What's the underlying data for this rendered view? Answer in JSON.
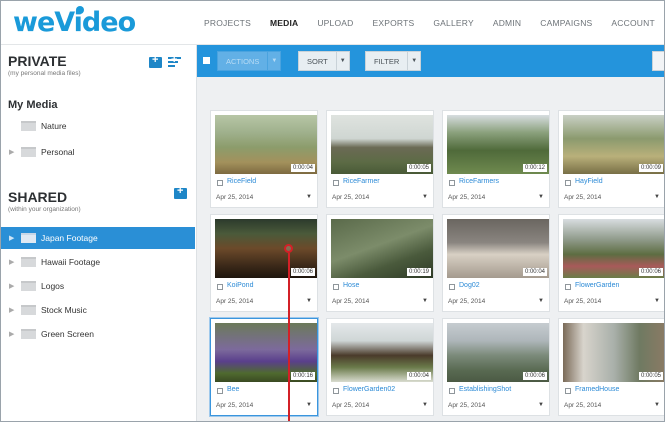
{
  "app": {
    "logo": "weVideo"
  },
  "nav": [
    "PROJECTS",
    "MEDIA",
    "UPLOAD",
    "EXPORTS",
    "GALLERY",
    "ADMIN",
    "CAMPAIGNS",
    "ACCOUNT"
  ],
  "nav_active": "MEDIA",
  "sidebar": {
    "private": {
      "title": "PRIVATE",
      "subtitle": "(my personal media files)"
    },
    "my_media": "My Media",
    "my_folders": [
      "Nature",
      "Personal"
    ],
    "shared": {
      "title": "SHARED",
      "subtitle": "(within your organization)"
    },
    "shared_folders": [
      "Japan Footage",
      "Hawaii Footage",
      "Logos",
      "Stock Music",
      "Green Screen"
    ],
    "selected_folder": "Japan Footage"
  },
  "toolbar": {
    "actions": "ACTIONS",
    "sort": "SORT",
    "filter": "FILTER"
  },
  "media": [
    {
      "name": "RiceField",
      "duration": "0:00:04",
      "date": "Apr 25, 2014",
      "thumb": "field"
    },
    {
      "name": "RiceFarmer",
      "duration": "0:00:05",
      "date": "Apr 25, 2014",
      "thumb": "house"
    },
    {
      "name": "RiceFarmers",
      "duration": "0:00:12",
      "date": "Apr 25, 2014",
      "thumb": "farm"
    },
    {
      "name": "HayField",
      "duration": "0:00:09",
      "date": "Apr 25, 2014",
      "thumb": "grass"
    },
    {
      "name": "KoiPond",
      "duration": "0:00:06",
      "date": "Apr 25, 2014",
      "thumb": "pond"
    },
    {
      "name": "Hose",
      "duration": "0:00:19",
      "date": "Apr 25, 2014",
      "thumb": "hose"
    },
    {
      "name": "Dog02",
      "duration": "0:00:04",
      "date": "Apr 25, 2014",
      "thumb": "dog"
    },
    {
      "name": "FlowerGarden",
      "duration": "0:00:06",
      "date": "Apr 25, 2014",
      "thumb": "village"
    },
    {
      "name": "Bee",
      "duration": "0:00:16",
      "date": "Apr 25, 2014",
      "thumb": "flowers"
    },
    {
      "name": "FlowerGarden02",
      "duration": "0:00:04",
      "date": "Apr 25, 2014",
      "thumb": "house2"
    },
    {
      "name": "EstablishingShot",
      "duration": "0:00:06",
      "date": "Apr 25, 2014",
      "thumb": "valley"
    },
    {
      "name": "FramedHouse",
      "duration": "0:00:05",
      "date": "Apr 25, 2014",
      "thumb": "framed"
    }
  ],
  "selected_media": "Bee",
  "colors": {
    "accent": "#2494dc",
    "link": "#2b8ad6",
    "annotation": "#d32027"
  }
}
